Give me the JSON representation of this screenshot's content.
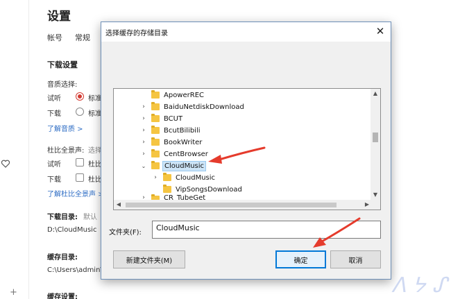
{
  "colors": {
    "accent_red": "#d33a31",
    "link_blue": "#2d6cc4",
    "selected_bg": "#cce4f7",
    "primary_border": "#0078d7"
  },
  "settings": {
    "title": "设置",
    "tabs": [
      "帐号",
      "常规"
    ],
    "download_section": "下载设置",
    "quality_label": "音质选择:",
    "listen_label": "试听",
    "listen_value": "标准",
    "download_label": "下载",
    "download_value": "标准",
    "learn_quality": "了解音质 >",
    "dolby_label": "杜比全景声:",
    "dolby_hint": "选择",
    "dolby_listen": "试听",
    "dolby_listen_value": "杜比",
    "dolby_download": "下载",
    "dolby_download_value": "杜比",
    "learn_dolby": "了解杜比全景声 >",
    "download_dir_label": "下载目录:",
    "download_dir_hint": "默认",
    "download_dir_path": "D:\\CloudMusic",
    "cache_dir_label": "缓存目录:",
    "cache_dir_path": "C:\\Users\\admin\\A",
    "cache_settings_label": "缓存设置:"
  },
  "dialog": {
    "title": "选择缓存的存储目录",
    "close_glyph": "✕",
    "tree": [
      {
        "label": "ApowerREC",
        "expander": ""
      },
      {
        "label": "BaiduNetdiskDownload",
        "expander": "›"
      },
      {
        "label": "BCUT",
        "expander": "›"
      },
      {
        "label": "BcutBilibili",
        "expander": "›"
      },
      {
        "label": "BookWriter",
        "expander": "›"
      },
      {
        "label": "CentBrowser",
        "expander": "›"
      },
      {
        "label": "CloudMusic",
        "expander": "⌄",
        "selected": true
      },
      {
        "label": "CloudMusic",
        "expander": "›"
      },
      {
        "label": "VipSongsDownload",
        "expander": ""
      },
      {
        "label": "CR_TubeGet",
        "expander": "›"
      }
    ],
    "folder_label": "文件夹(F):",
    "folder_value": "CloudMusic",
    "new_folder_button": "新建文件夹(M)",
    "ok_button": "确定",
    "cancel_button": "取消"
  },
  "icons": [
    "heart-icon",
    "plus-icon",
    "folder-icon",
    "chevron-right-icon",
    "chevron-down-icon",
    "close-icon",
    "scroll-up-icon",
    "scroll-down-icon",
    "scroll-left-icon",
    "scroll-right-icon"
  ]
}
